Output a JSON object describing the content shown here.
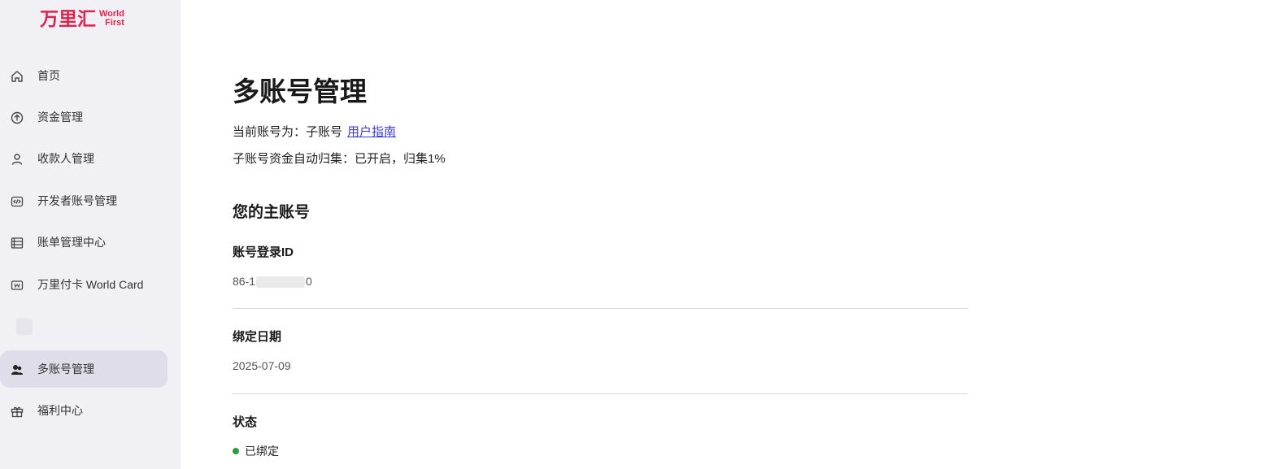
{
  "brand": {
    "name_cn": "万里汇",
    "name_en_line1": "World",
    "name_en_line2": "First"
  },
  "sidebar": {
    "items": [
      {
        "label": "首页",
        "icon": "home-icon"
      },
      {
        "label": "资金管理",
        "icon": "arrow-up-circle-icon"
      },
      {
        "label": "收款人管理",
        "icon": "person-icon"
      },
      {
        "label": "开发者账号管理",
        "icon": "code-icon"
      },
      {
        "label": "账单管理中心",
        "icon": "list-icon"
      },
      {
        "label": "万里付卡 World Card",
        "icon": "card-icon"
      },
      {
        "label": "多账号管理",
        "icon": "multi-user-icon",
        "active": true
      },
      {
        "label": "福利中心",
        "icon": "gift-icon"
      }
    ]
  },
  "main": {
    "title": "多账号管理",
    "current_account_prefix": "当前账号为：子账号",
    "user_guide_link": "用户指南",
    "auto_collect": "子账号资金自动归集：已开启，归集1%",
    "section_title": "您的主账号",
    "fields": {
      "login_id_label": "账号登录ID",
      "login_id_prefix": "86-1",
      "login_id_suffix": "0",
      "bind_date_label": "绑定日期",
      "bind_date_value": "2025-07-09",
      "status_label": "状态",
      "status_value": "已绑定"
    },
    "colors": {
      "status_dot": "#2a9d3c",
      "link": "#3b3bd6",
      "brand": "#e0224e"
    }
  }
}
